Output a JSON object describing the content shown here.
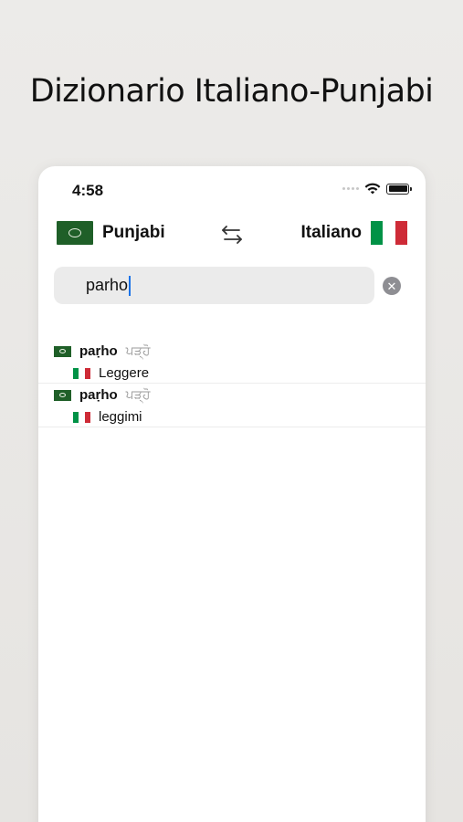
{
  "headline": "Dizionario Italiano-Punjabi",
  "status_bar": {
    "time": "4:58"
  },
  "language_bar": {
    "source_label": "Punjabi",
    "target_label": "Italiano",
    "swap_icon": "swap-arrows-icon"
  },
  "search": {
    "value": "parho",
    "clear_icon": "clear-circle-icon",
    "clear_glyph": "✕"
  },
  "results": [
    {
      "word": "paṛho",
      "script": "ਪੜ੍ਹੋ",
      "translation": "Leggere"
    },
    {
      "word": "paṛho",
      "script": "ਪੜ੍ਹੋ",
      "translation": "leggimi"
    }
  ],
  "colors": {
    "pakistan_green": "#1f5f28",
    "italy_green": "#009246",
    "italy_white": "#ffffff",
    "italy_red": "#ce2b37",
    "caret_blue": "#1a73e8"
  }
}
